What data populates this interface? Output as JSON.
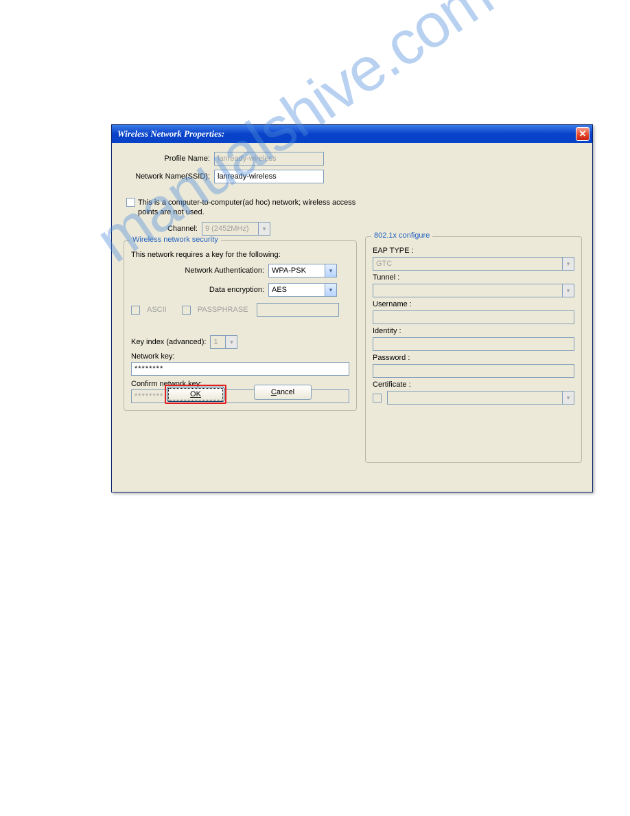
{
  "window": {
    "title": "Wireless Network Properties:"
  },
  "profile": {
    "label": "Profile Name:",
    "value": "lanready-wireless",
    "ssid_label": "Network Name(SSID):",
    "ssid_value": "lanready-wireless"
  },
  "adhoc": {
    "text": "This is a computer-to-computer(ad hoc) network; wireless access points are not used.",
    "channel_label": "Channel:",
    "channel_value": "9 (2452MHz)"
  },
  "security": {
    "legend": "Wireless network security",
    "desc": "This network requires a key for the following:",
    "auth_label": "Network Authentication:",
    "auth_value": "WPA-PSK",
    "enc_label": "Data encryption:",
    "enc_value": "AES",
    "ascii_label": "ASCII",
    "pass_label": "PASSPHRASE",
    "keyidx_label": "Key index (advanced):",
    "keyidx_value": "1",
    "netkey_label": "Network key:",
    "netkey_value": "********",
    "confirm_label": "Confirm network key:",
    "confirm_value": "********"
  },
  "dot1x": {
    "legend": "802.1x configure",
    "eap_label": "EAP TYPE :",
    "eap_value": "GTC",
    "tunnel_label": "Tunnel :",
    "username_label": "Username :",
    "identity_label": "Identity :",
    "password_label": "Password :",
    "cert_label": "Certificate :"
  },
  "buttons": {
    "ok": "OK",
    "cancel": "Cancel"
  },
  "watermark": "manualshive.com"
}
